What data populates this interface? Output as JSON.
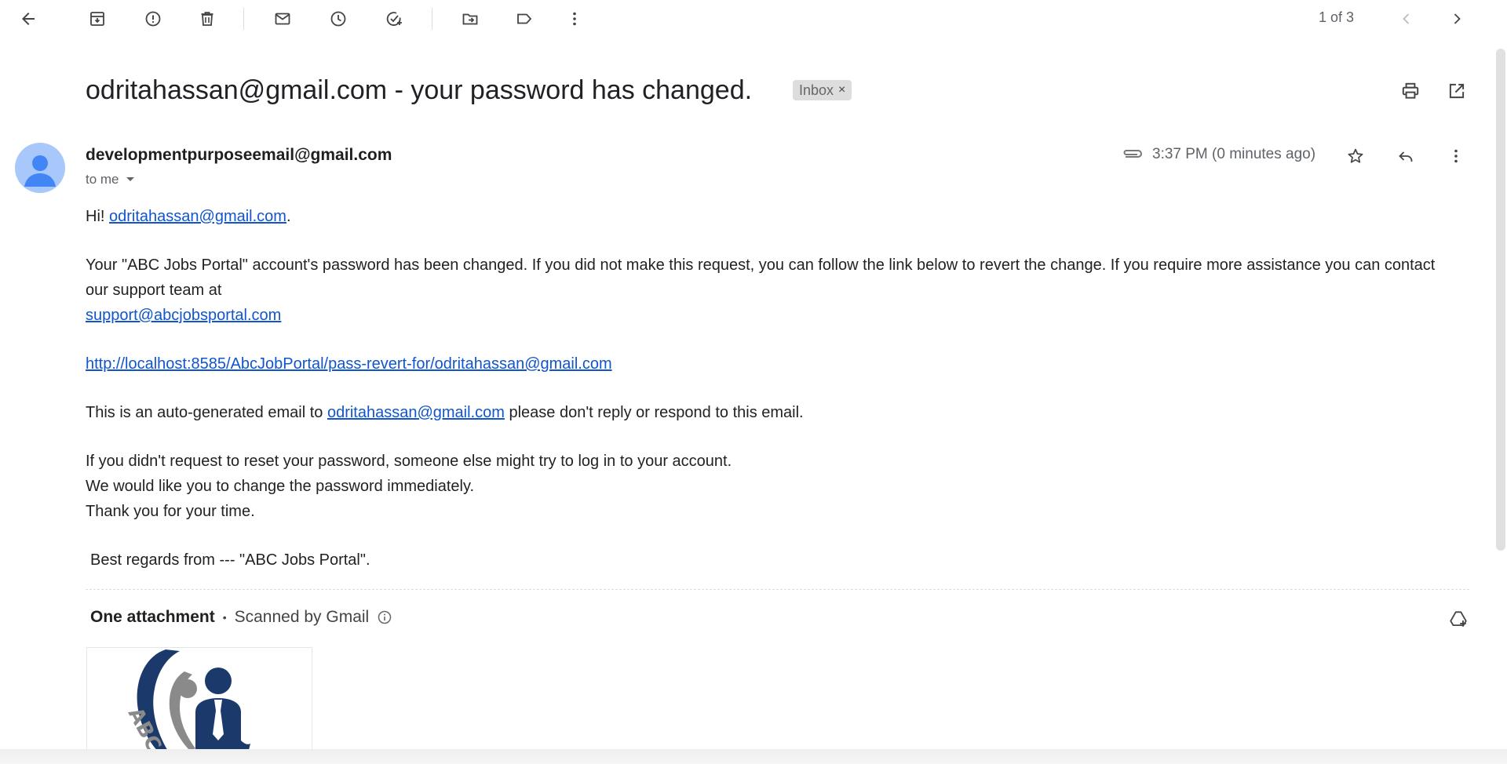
{
  "toolbar": {
    "back": "arrow-left-icon",
    "archive": "archive-icon",
    "report_spam": "report-spam-icon",
    "delete": "trash-icon",
    "mark_unread": "mail-icon",
    "snooze": "clock-icon",
    "add_task": "add-task-icon",
    "move_to": "folder-move-icon",
    "labels": "label-icon",
    "more": "more-vertical-icon",
    "pager_text": "1 of 3",
    "older": "chevron-left-icon",
    "newer": "chevron-right-icon"
  },
  "email": {
    "subject": "odritahassan@gmail.com - your password has changed.",
    "label": "Inbox",
    "label_remove": "×",
    "sender": "developmentpurposeemail@gmail.com",
    "to": "to me",
    "time": "3:37 PM (0 minutes ago)",
    "body": {
      "greeting_prefix": "Hi! ",
      "greeting_link": "odritahassan@gmail.com",
      "greeting_suffix": ".",
      "para1": "Your \"ABC Jobs Portal\" account's password has been changed. If you did not make this request, you can follow the link below to revert the change. If you require more assistance you can contact our support team at",
      "support_link": "support@abcjobsportal.com",
      "revert_link": "http://localhost:8585/AbcJobPortal/pass-revert-for/odritahassan@gmail.com",
      "auto_prefix": "This is an auto-generated email to ",
      "auto_link": "odritahassan@gmail.com",
      "auto_suffix": " please don't reply or respond to this email.",
      "line1": "If you didn't request to reset your password, someone else might try to log in to your account.",
      "line2": "We would like you to change the password immediately.",
      "line3": "Thank you for your time.",
      "regards": "Best regards from --- \"ABC Jobs Portal\"."
    },
    "attachments": {
      "title": "One attachment",
      "separator": "•",
      "scanned": "Scanned by Gmail",
      "thumb_text": "ABC"
    }
  },
  "colors": {
    "link": "#1155cc",
    "avatar_bg": "#a8c7fa",
    "avatar_fg": "#4285f4",
    "logo_navy": "#1b3a6b",
    "logo_gray": "#8a8a8a"
  }
}
